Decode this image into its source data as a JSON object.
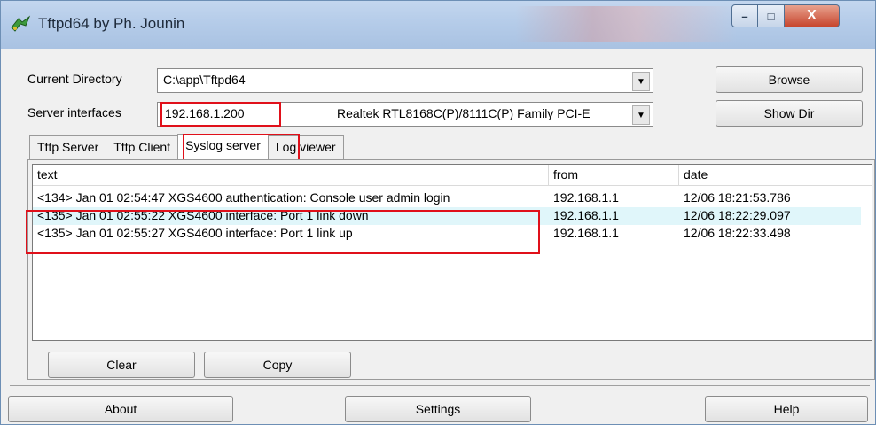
{
  "window": {
    "title": "Tftpd64 by Ph. Jounin",
    "controls": {
      "minimize": "–",
      "maximize": "□",
      "close": "X"
    }
  },
  "config": {
    "current_directory_label": "Current Directory",
    "current_directory_value": "C:\\app\\Tftpd64",
    "server_interfaces_label": "Server interfaces",
    "server_ip": "192.168.1.200",
    "server_adapter": "Realtek RTL8168C(P)/8111C(P) Family PCI-E",
    "browse_button": "Browse",
    "show_dir_button": "Show Dir"
  },
  "tabs": [
    {
      "label": "Tftp Server",
      "active": false
    },
    {
      "label": "Tftp Client",
      "active": false
    },
    {
      "label": "Syslog server",
      "active": true
    },
    {
      "label": "Log viewer",
      "active": false
    }
  ],
  "syslog": {
    "columns": [
      "text",
      "from",
      "date"
    ],
    "rows": [
      {
        "text": "<134> Jan 01 02:54:47 XGS4600 authentication: Console user admin login",
        "from": "192.168.1.1",
        "date": "12/06 18:21:53.786",
        "selected": false
      },
      {
        "text": "<135> Jan 01 02:55:22 XGS4600 interface: Port 1 link down",
        "from": "192.168.1.1",
        "date": "12/06 18:22:29.097",
        "selected": true
      },
      {
        "text": "<135> Jan 01 02:55:27 XGS4600 interface: Port 1 link up",
        "from": "192.168.1.1",
        "date": "12/06 18:22:33.498",
        "selected": false
      }
    ],
    "clear_button": "Clear",
    "copy_button": "Copy"
  },
  "footer": {
    "about_button": "About",
    "settings_button": "Settings",
    "help_button": "Help"
  },
  "colors": {
    "annotation_red": "#e0101a",
    "selected_row": "#e0f6fa",
    "titlebar": "#b5cce9"
  },
  "icons": {
    "app": "tftpd-app-icon",
    "dropdown": "chevron-down-icon"
  }
}
